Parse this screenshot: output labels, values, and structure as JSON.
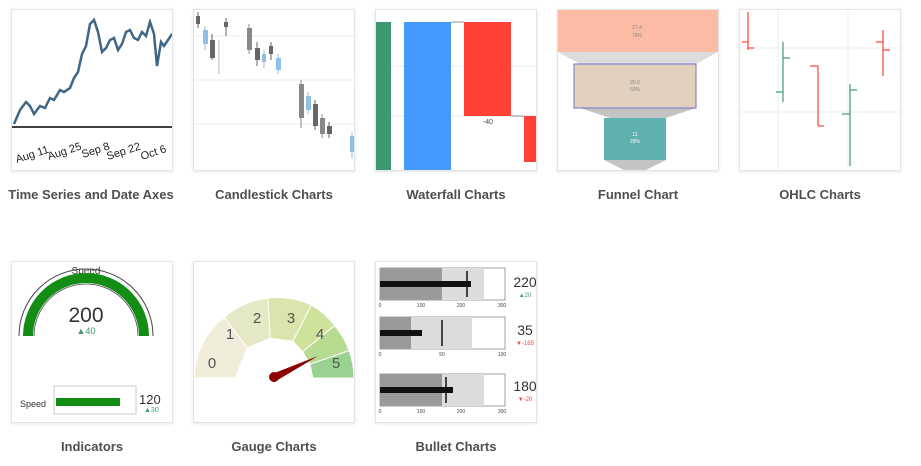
{
  "gallery": {
    "items": [
      {
        "title": "Time Series and Date Axes",
        "ticks": [
          "Aug 11",
          "Aug 25",
          "Sep 8",
          "Sep 22",
          "Oct 6"
        ]
      },
      {
        "title": "Candlestick Charts"
      },
      {
        "title": "Waterfall Charts",
        "bar_label": "-40"
      },
      {
        "title": "Funnel Chart",
        "stages": [
          {
            "value": "27.4",
            "percent": "76%"
          },
          {
            "value": "20.6",
            "percent": "53%"
          },
          {
            "value": "11",
            "percent": "28%"
          }
        ]
      },
      {
        "title": "OHLC Charts"
      },
      {
        "title": "Indicators",
        "gauge_title": "Speed",
        "gauge_value": "200",
        "gauge_delta": "▲40",
        "bar_title": "Speed",
        "bar_value": "120",
        "bar_delta": "▲30"
      },
      {
        "title": "Gauge Charts",
        "steps": [
          "0",
          "1",
          "2",
          "3",
          "4",
          "5"
        ]
      },
      {
        "title": "Bullet Charts",
        "bullets": [
          {
            "value": "220",
            "delta": "▲20",
            "ticks": [
              "0",
              "100",
              "200",
              "300"
            ]
          },
          {
            "value": "35",
            "delta": "▼-165",
            "ticks": [
              "0",
              "50",
              "100"
            ]
          },
          {
            "value": "180",
            "delta": "▼-20",
            "ticks": [
              "0",
              "100",
              "200",
              "300"
            ]
          }
        ]
      }
    ]
  },
  "colors": {
    "line": "#3f6687",
    "increase": "#3d9970",
    "decrease": "#ff4136",
    "waterfall_total": "#4499ff",
    "gauge_needle": "#8b0000",
    "bar": "#138d13"
  }
}
